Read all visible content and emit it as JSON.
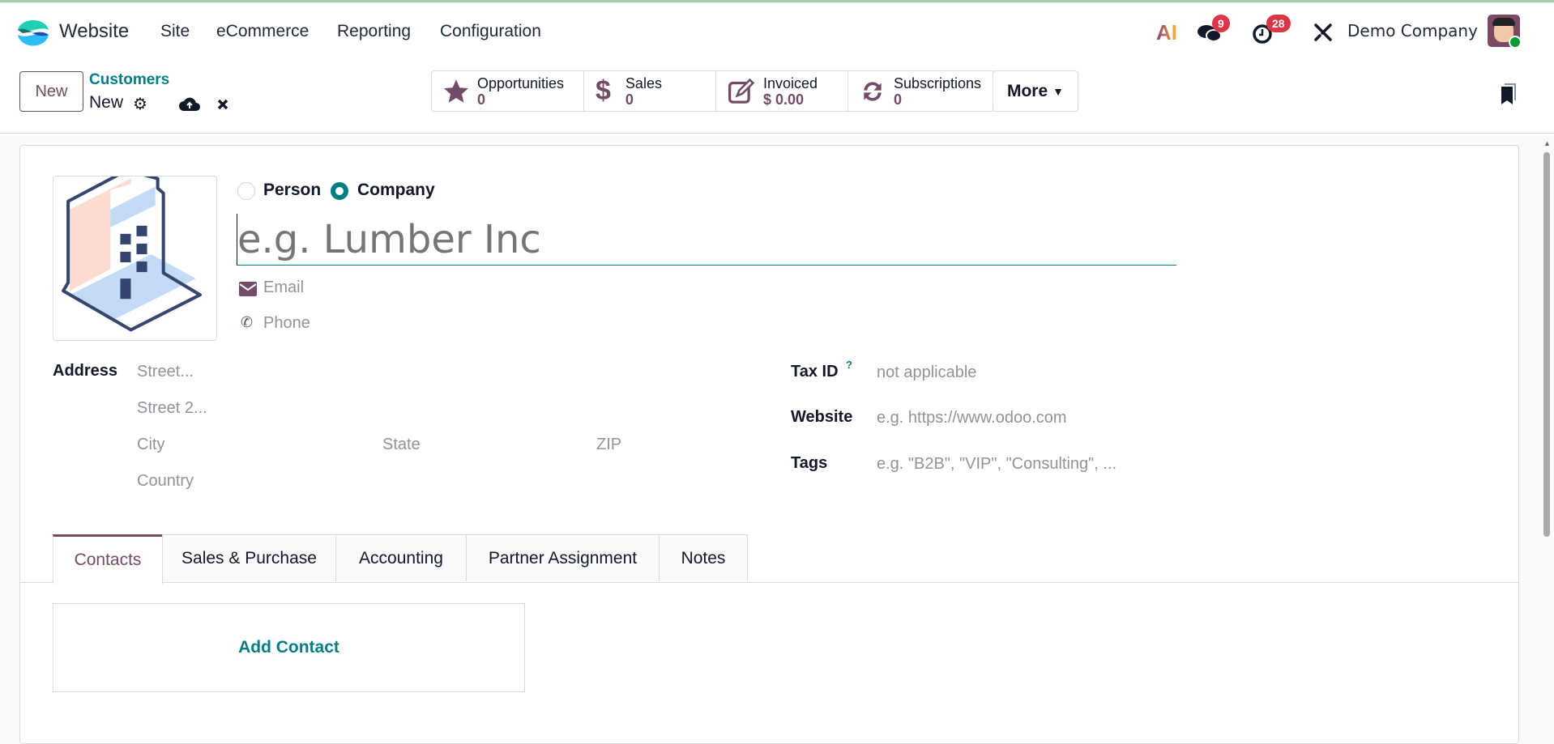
{
  "navbar": {
    "app_name": "Website",
    "menu": [
      "Site",
      "eCommerce",
      "Reporting",
      "Configuration"
    ],
    "ai_label": "AI",
    "messages_count": "9",
    "activities_count": "28",
    "company": "Demo Company"
  },
  "control_panel": {
    "new_button": "New",
    "breadcrumb_parent": "Customers",
    "breadcrumb_current": "New"
  },
  "stats": [
    {
      "label": "Opportunities",
      "value": "0",
      "icon": "star-icon"
    },
    {
      "label": "Sales",
      "value": "0",
      "icon": "dollar-icon"
    },
    {
      "label": "Invoiced",
      "value": "$ 0.00",
      "icon": "edit-icon"
    },
    {
      "label": "Subscriptions",
      "value": "0",
      "icon": "refresh-icon"
    }
  ],
  "more_label": "More",
  "form": {
    "type_options": [
      "Person",
      "Company"
    ],
    "selected_type": "Company",
    "name_placeholder": "e.g. Lumber Inc",
    "email_placeholder": "Email",
    "phone_placeholder": "Phone",
    "address_label": "Address",
    "street": "Street...",
    "street2": "Street 2...",
    "city": "City",
    "state": "State",
    "zip": "ZIP",
    "country": "Country",
    "taxid_label": "Tax ID",
    "taxid_help": "?",
    "taxid_placeholder": "not applicable",
    "website_label": "Website",
    "website_placeholder": "e.g. https://www.odoo.com",
    "tags_label": "Tags",
    "tags_placeholder": "e.g. \"B2B\", \"VIP\", \"Consulting\", ..."
  },
  "tabs": [
    "Contacts",
    "Sales & Purchase",
    "Accounting",
    "Partner Assignment",
    "Notes"
  ],
  "active_tab": "Contacts",
  "add_contact": "Add Contact",
  "colors": {
    "brand": "#714b67",
    "accent": "#017e84",
    "badge": "#dc3545"
  }
}
